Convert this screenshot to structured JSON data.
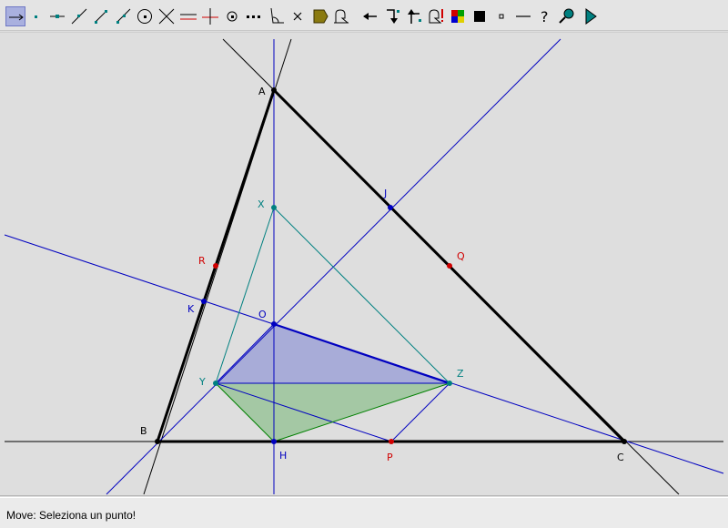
{
  "status": {
    "message": "Move: Seleziona un punto!"
  },
  "toolbar": {
    "tools": [
      "move-tool",
      "point-tool",
      "point-on-object-tool",
      "line-tool",
      "segment-tool",
      "ray-tool",
      "circle-tool",
      "intersection-tool",
      "parallel-line-tool",
      "perpendicular-line-tool",
      "center-tool",
      "locus-tool",
      "angle-tool",
      "delete-tool",
      "polygon-tool",
      "measure-tool",
      "undo-tool",
      "macro-start-tool",
      "macro-end-tool",
      "macro-run-tool",
      "color-palette-tool",
      "fill-tool",
      "point-size-tool",
      "line-style-tool",
      "help-tool",
      "zoom-tool",
      "animate-tool"
    ],
    "active_tool": "move-tool"
  },
  "colors": {
    "black": "#000000",
    "blue": "#0000c0",
    "teal": "#008080",
    "red": "#d00000",
    "green": "#008000",
    "blue_fill": "#a8acd8",
    "green_fill": "#a4c8a4"
  },
  "geometry": {
    "labels": {
      "A": "A",
      "B": "B",
      "C": "C",
      "J": "J",
      "Q": "Q",
      "X": "X",
      "R": "R",
      "K": "K",
      "O": "O",
      "Y": "Y",
      "Z": "Z",
      "H": "H",
      "P": "P"
    }
  }
}
